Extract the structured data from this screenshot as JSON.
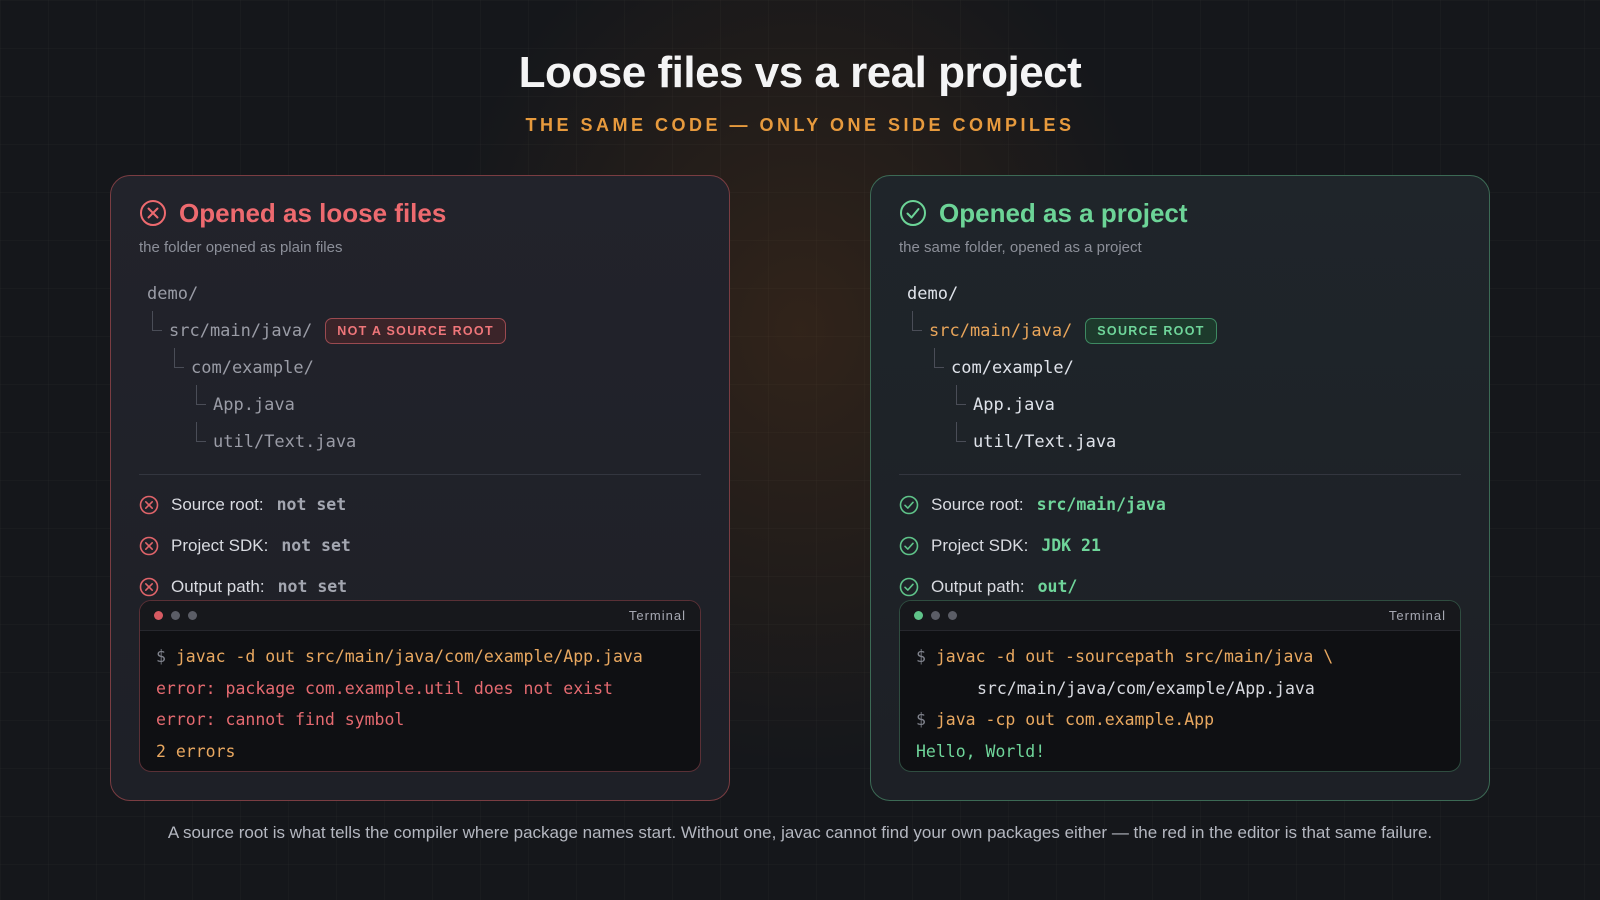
{
  "header": {
    "title": "Loose files vs a real project",
    "subtitle": "THE SAME CODE — ONLY ONE SIDE COMPILES"
  },
  "left_panel": {
    "icon": "x-circle-icon",
    "accent": "#ee6a6f",
    "title": "Opened as loose files",
    "description": "the folder opened as plain files",
    "tree": {
      "root": "demo/",
      "src": "src/main/java/",
      "badge": "NOT A SOURCE ROOT",
      "pkg": "com/example/",
      "file1": "App.java",
      "file2": "util/Text.java"
    },
    "checks": [
      {
        "label": "Source root:",
        "value": "not set",
        "icon": "x-circle-icon"
      },
      {
        "label": "Project SDK:",
        "value": "not set",
        "icon": "x-circle-icon"
      },
      {
        "label": "Output path:",
        "value": "not set",
        "icon": "x-circle-icon"
      }
    ],
    "terminal": {
      "title": "Terminal",
      "prompt": "$",
      "line1": "javac -d out src/main/java/com/example/App.java",
      "line2": "error: package com.example.util does not exist",
      "line3": "error: cannot find symbol",
      "line4": "2 errors"
    }
  },
  "right_panel": {
    "icon": "check-circle-icon",
    "accent": "#6cd497",
    "title": "Opened as a project",
    "description": "the same folder, opened as a project",
    "tree": {
      "root": "demo/",
      "src": "src/main/java/",
      "badge": "SOURCE ROOT",
      "pkg": "com/example/",
      "file1": "App.java",
      "file2": "util/Text.java"
    },
    "checks": [
      {
        "label": "Source root:",
        "value": "src/main/java",
        "icon": "check-circle-icon"
      },
      {
        "label": "Project SDK:",
        "value": "JDK 21",
        "icon": "check-circle-icon"
      },
      {
        "label": "Output path:",
        "value": "out/",
        "icon": "check-circle-icon"
      }
    ],
    "terminal": {
      "title": "Terminal",
      "prompt": "$",
      "line1": "javac -d out -sourcepath src/main/java \\",
      "line2": "src/main/java/com/example/App.java",
      "line3": "java -cp out com.example.App",
      "line4": "Hello, World!"
    }
  },
  "footer": "A source root is what tells the compiler where package names start. Without one, javac cannot find your own packages either — the red in the editor is that same failure."
}
